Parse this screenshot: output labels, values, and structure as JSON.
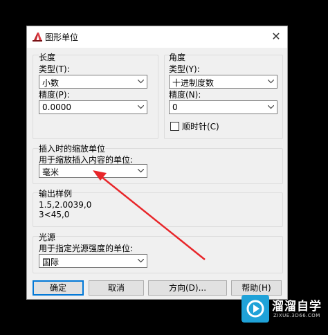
{
  "dialog": {
    "title": "图形单位",
    "close_glyph": "✕"
  },
  "length": {
    "group_title": "长度",
    "type_label": "类型(T):",
    "type_value": "小数",
    "precision_label": "精度(P):",
    "precision_value": "0.0000"
  },
  "angle": {
    "group_title": "角度",
    "type_label": "类型(Y):",
    "type_value": "十进制度数",
    "precision_label": "精度(N):",
    "precision_value": "0",
    "clockwise_label": "顺时针(C)",
    "clockwise_checked": false
  },
  "insert_scale": {
    "group_title": "插入时的缩放单位",
    "units_label": "用于缩放插入内容的单位:",
    "units_value": "毫米"
  },
  "sample_output": {
    "group_title": "输出样例",
    "line1": "1.5,2.0039,0",
    "line2": "3<45,0"
  },
  "lighting": {
    "group_title": "光源",
    "units_label": "用于指定光源强度的单位:",
    "units_value": "国际"
  },
  "buttons": {
    "ok": "确定",
    "cancel": "取消",
    "direction": "方向(D)...",
    "help": "帮助(H)"
  },
  "watermark": {
    "name": "溜溜自学",
    "url": "ZIXUE.3D66.COM"
  },
  "colors": {
    "annotation_arrow": "#e8262a",
    "default_button_border": "#0078d7"
  }
}
